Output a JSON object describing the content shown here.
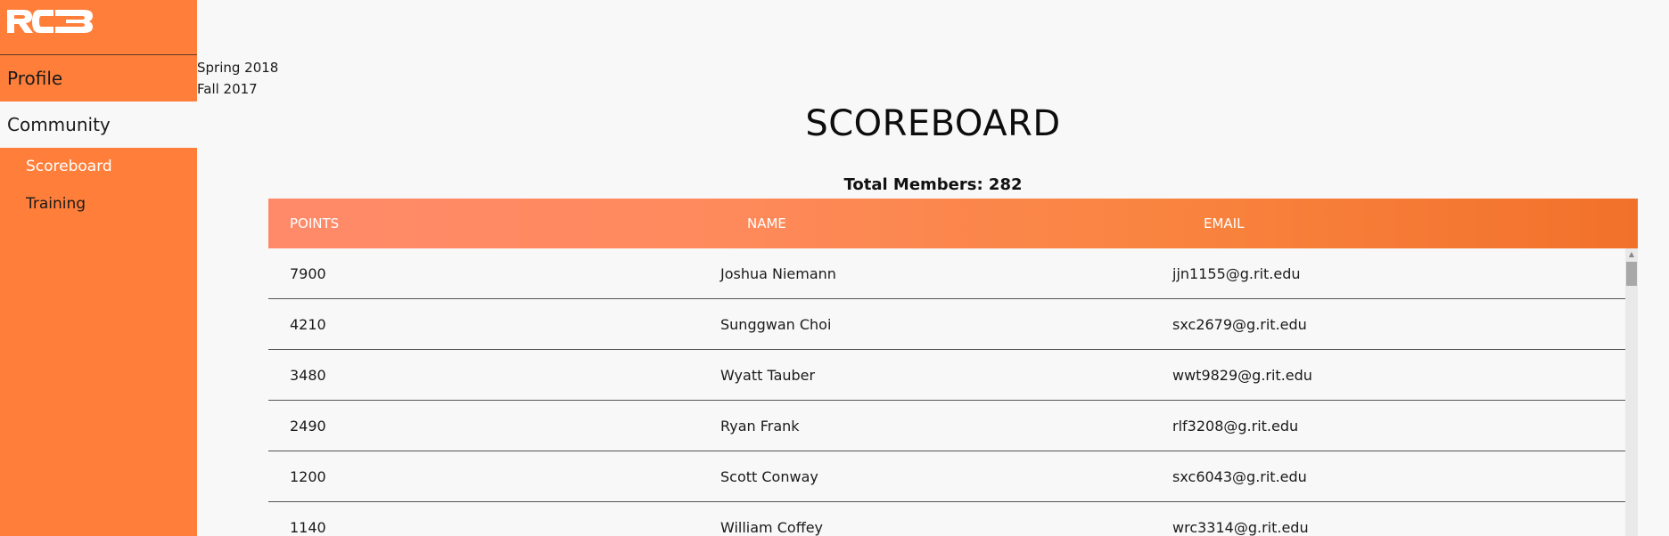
{
  "sidebar": {
    "logo_text": "RC3",
    "nav": [
      {
        "label": "Profile"
      },
      {
        "label": "Community"
      }
    ],
    "sub_items": [
      {
        "label": "Scoreboard"
      },
      {
        "label": "Training"
      }
    ]
  },
  "semesters": [
    "Spring 2018",
    "Fall 2017"
  ],
  "page": {
    "title": "SCOREBOARD",
    "total_members_label": "Total Members: 282"
  },
  "table": {
    "columns": [
      "POINTS",
      "NAME",
      "EMAIL"
    ],
    "rows": [
      {
        "points": "7900",
        "name": "Joshua Niemann",
        "email": "jjn1155@g.rit.edu"
      },
      {
        "points": "4210",
        "name": "Sunggwan Choi",
        "email": "sxc2679@g.rit.edu"
      },
      {
        "points": "3480",
        "name": "Wyatt Tauber",
        "email": "wwt9829@g.rit.edu"
      },
      {
        "points": "2490",
        "name": "Ryan Frank",
        "email": "rlf3208@g.rit.edu"
      },
      {
        "points": "1200",
        "name": "Scott Conway",
        "email": "sxc6043@g.rit.edu"
      },
      {
        "points": "1140",
        "name": "William Coffey",
        "email": "wrc3314@g.rit.edu"
      }
    ]
  },
  "colors": {
    "brand": "#ff7f3a",
    "header_gradient_start": "#ff8a6a",
    "header_gradient_end": "#f2712a",
    "background": "#f8f8f8"
  }
}
